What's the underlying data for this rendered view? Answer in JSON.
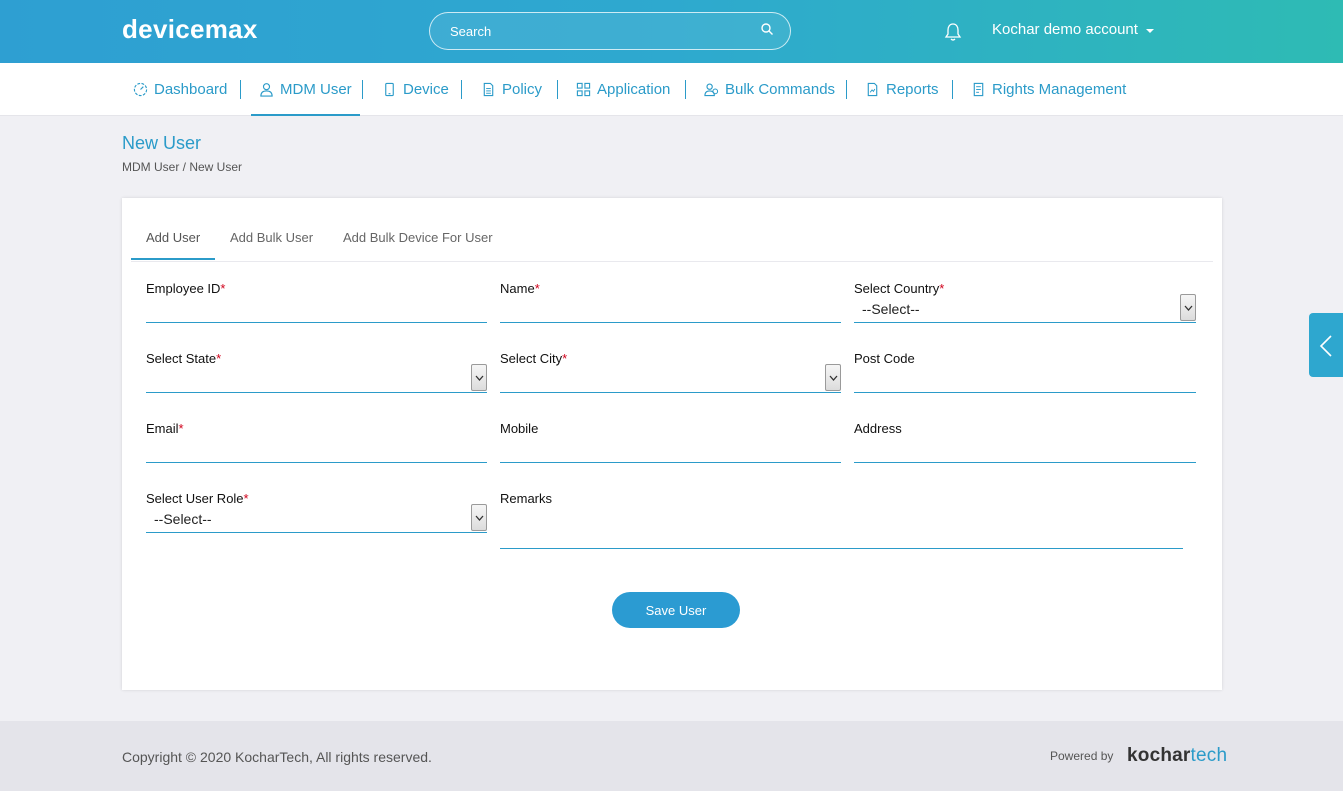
{
  "app": {
    "logo": "devicemax",
    "account_label": "Kochar demo account"
  },
  "search": {
    "placeholder": "Search"
  },
  "nav": {
    "items": [
      {
        "label": "Dashboard",
        "icon": "dashboard-icon"
      },
      {
        "label": "MDM User",
        "icon": "user-icon",
        "active": true
      },
      {
        "label": "Device",
        "icon": "mobile-icon"
      },
      {
        "label": "Policy",
        "icon": "document-icon"
      },
      {
        "label": "Application",
        "icon": "apps-grid-icon"
      },
      {
        "label": "Bulk Commands",
        "icon": "users-icon"
      },
      {
        "label": "Reports",
        "icon": "report-icon"
      },
      {
        "label": "Rights Management",
        "icon": "rights-icon"
      }
    ]
  },
  "page": {
    "title": "New User",
    "breadcrumb": "MDM User / New User"
  },
  "tabs": [
    {
      "label": "Add User",
      "active": true
    },
    {
      "label": "Add Bulk User"
    },
    {
      "label": "Add Bulk Device For User"
    }
  ],
  "form": {
    "employee_id": {
      "label": "Employee ID",
      "required": "*",
      "value": ""
    },
    "name": {
      "label": "Name",
      "required": "*",
      "value": ""
    },
    "country": {
      "label": "Select Country",
      "required": "*",
      "selected": "--Select--"
    },
    "state": {
      "label": "Select State",
      "required": "*",
      "selected": ""
    },
    "city": {
      "label": "Select City",
      "required": "*",
      "selected": ""
    },
    "post_code": {
      "label": "Post Code",
      "value": ""
    },
    "email": {
      "label": "Email",
      "required": "*",
      "value": ""
    },
    "mobile": {
      "label": "Mobile",
      "value": ""
    },
    "address": {
      "label": "Address",
      "value": ""
    },
    "user_role": {
      "label": "Select User Role",
      "required": "*",
      "selected": "--Select--"
    },
    "remarks": {
      "label": "Remarks",
      "value": ""
    },
    "save_label": "Save User"
  },
  "footer": {
    "copyright": "Copyright © 2020 KocharTech, All rights reserved.",
    "powered_by": "Powered by",
    "brand_part1": "kochar",
    "brand_part2": "tech"
  },
  "colors": {
    "accent": "#2b9bc9",
    "header_start": "#2e9fd2",
    "header_end": "#2ebbb4",
    "required": "#d0021b"
  }
}
